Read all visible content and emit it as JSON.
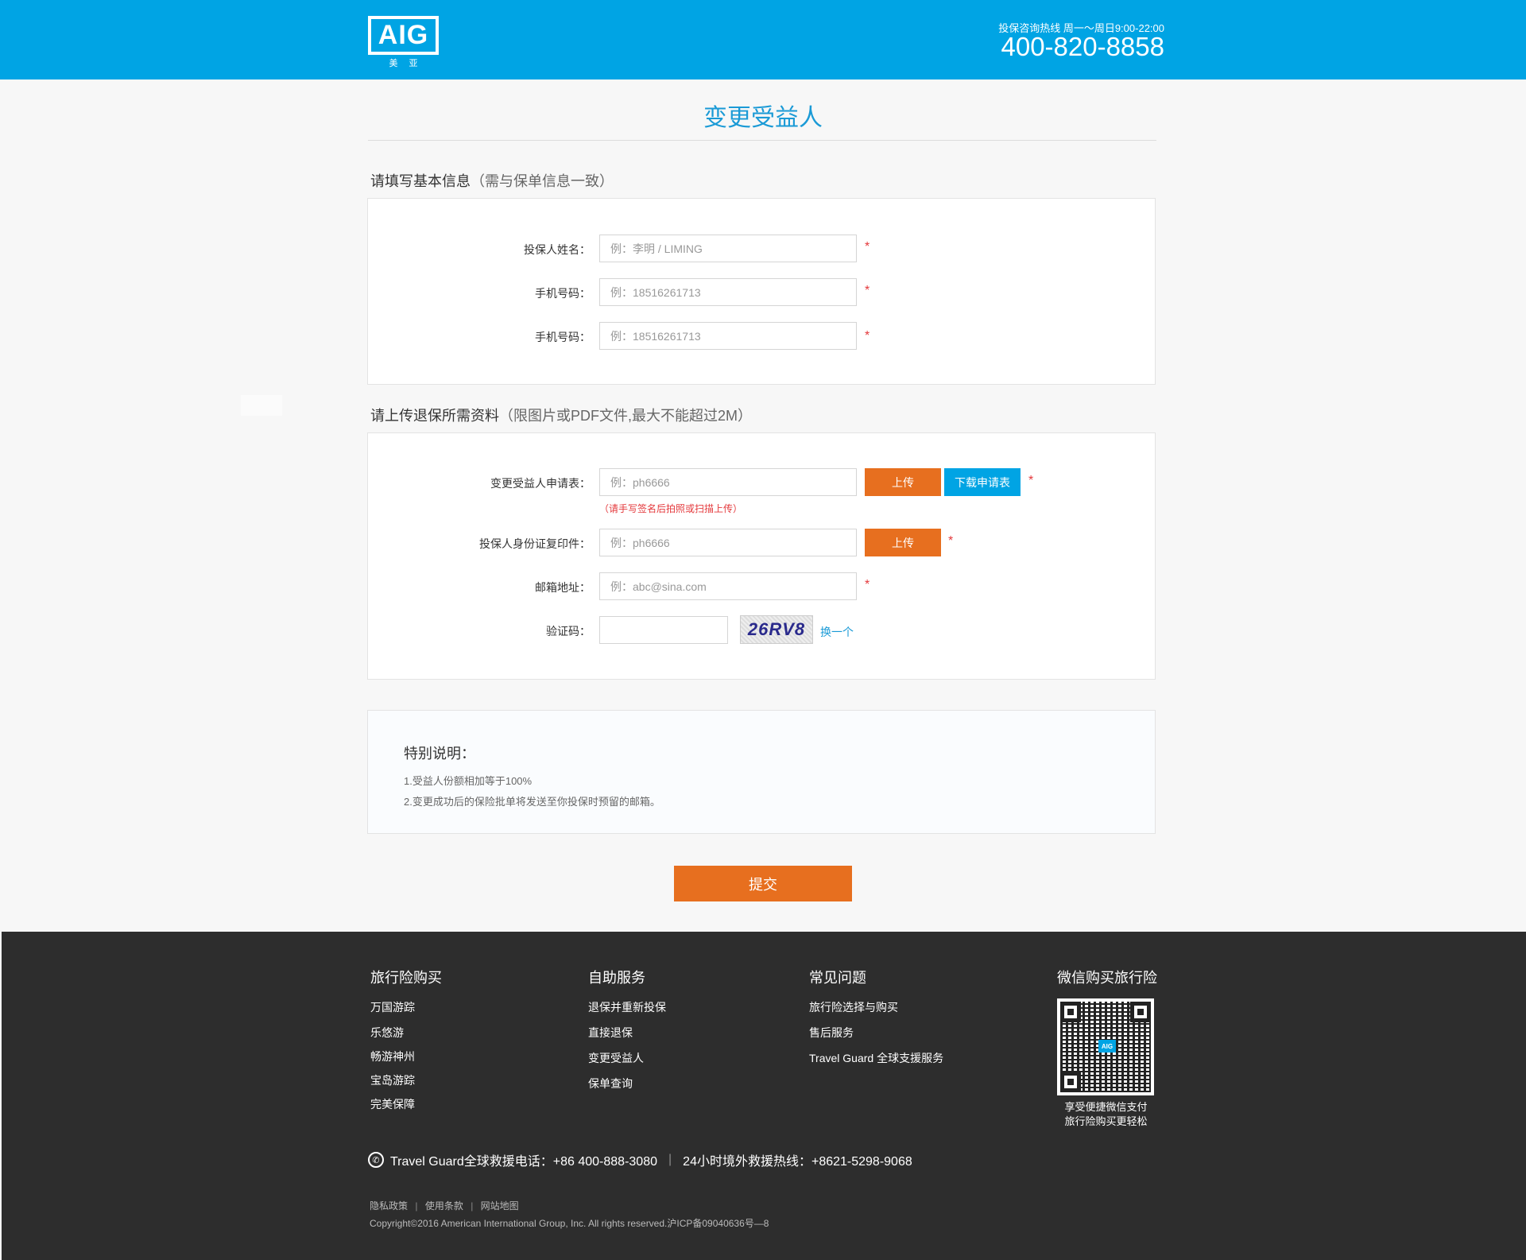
{
  "header": {
    "logo_text": "AIG",
    "logo_sub": [
      "美",
      "亚"
    ],
    "hotline_label": "投保咨询热线 周一～周日9:00-22:00",
    "hotline_number": "400-820-8858"
  },
  "page_title": "变更受益人",
  "section1": {
    "title": "请填写基本信息",
    "note": "（需与保单信息一致）",
    "fields": [
      {
        "label": "投保人姓名：",
        "placeholder": "例：李明 / LIMING",
        "required": "*"
      },
      {
        "label": "手机号码：",
        "placeholder": "例：18516261713",
        "required": "*"
      },
      {
        "label": "手机号码：",
        "placeholder": "例：18516261713",
        "required": "*"
      }
    ]
  },
  "section2": {
    "title": "请上传退保所需资料",
    "note": "（限图片或PDF文件,最大不能超过2M）",
    "application": {
      "label": "变更受益人申请表：",
      "placeholder": "例：ph6666",
      "upload": "上传",
      "download": "下载申请表",
      "hint": "（请手写签名后拍照或扫描上传）",
      "required": "*"
    },
    "id_copy": {
      "label": "投保人身份证复印件：",
      "placeholder": "例：ph6666",
      "upload": "上传",
      "required": "*"
    },
    "email": {
      "label": "邮箱地址：",
      "placeholder": "例：abc@sina.com",
      "required": "*"
    },
    "captcha": {
      "label": "验证码：",
      "value": "",
      "image_text": "26RV8",
      "refresh": "换一个"
    }
  },
  "notice": {
    "title": "特别说明：",
    "lines": [
      "1.受益人份额相加等于100%",
      "2.变更成功后的保险批单将发送至你投保时预留的邮箱。"
    ]
  },
  "submit_label": "提交",
  "footer": {
    "columns": [
      {
        "title": "旅行险购买",
        "links": [
          "万国游踪",
          "乐悠游",
          "畅游神州",
          "宝岛游踪",
          "完美保障"
        ]
      },
      {
        "title": "自助服务",
        "links": [
          "退保并重新投保",
          "直接退保",
          "变更受益人",
          "保单查询"
        ]
      },
      {
        "title": "常见问题",
        "links": [
          "旅行险选择与购买",
          "售后服务",
          "Travel Guard 全球支援服务"
        ]
      }
    ],
    "wechat": {
      "title": "微信购买旅行险",
      "qr_logo": "AIG",
      "caption1": "享受便捷微信支付",
      "caption2": "旅行险购买更轻松"
    },
    "rescue_phone": "Travel Guard全球救援电话：+86 400-888-3080",
    "overseas_hotline": "24小时境外救援热线：+8621-5298-9068",
    "sep": "|",
    "legal_links": [
      "隐私政策",
      "使用条款",
      "网站地图"
    ],
    "copyright": "Copyright©2016 American International Group, Inc. All rights reserved.沪ICP备09040636号—8"
  }
}
